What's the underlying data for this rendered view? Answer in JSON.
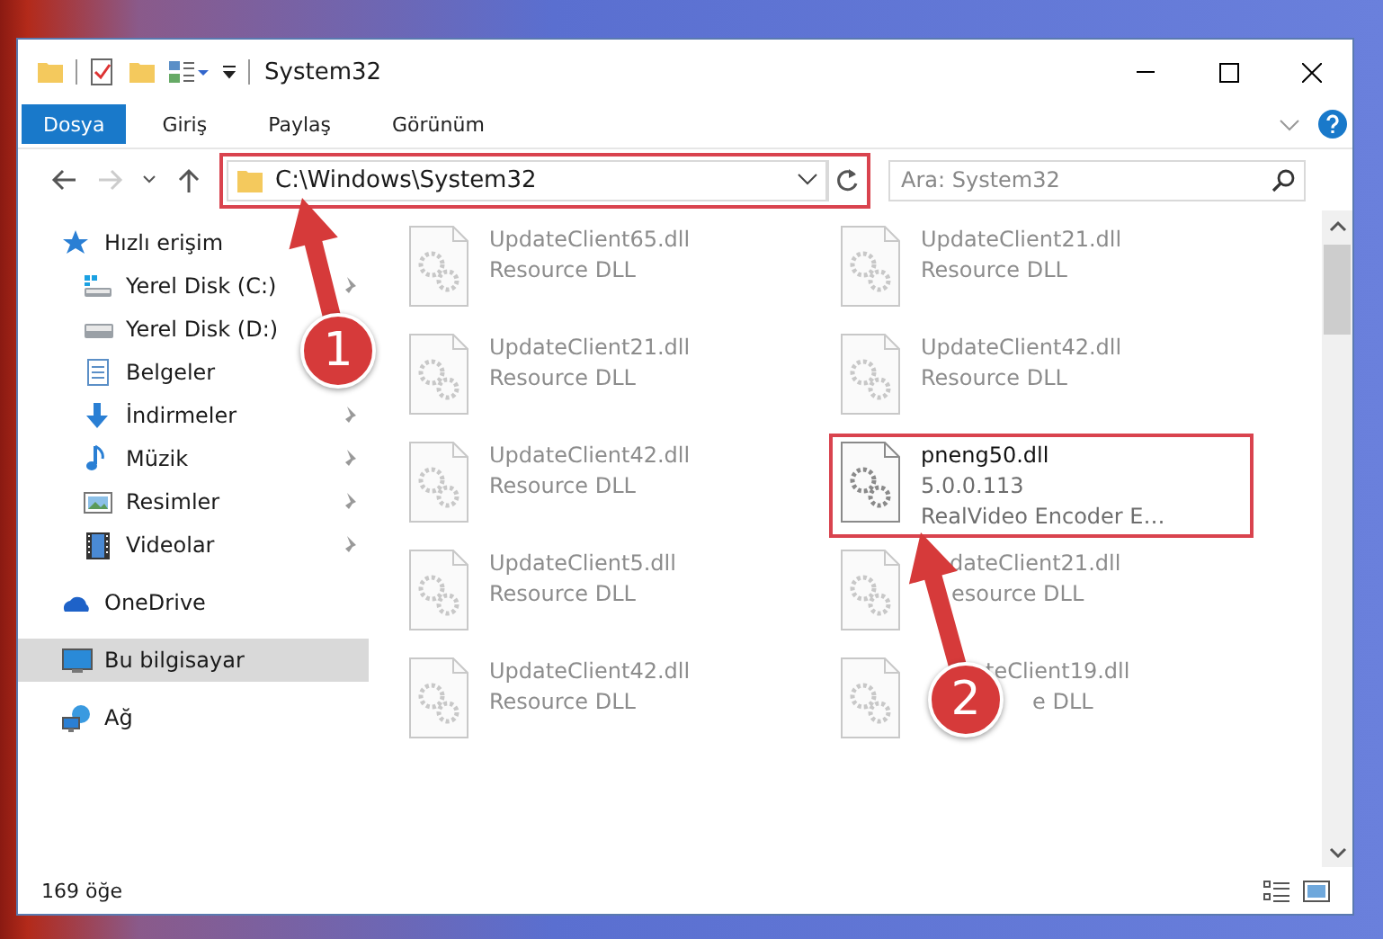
{
  "window": {
    "title": "System32"
  },
  "ribbon": {
    "tabs": [
      {
        "label": "Dosya",
        "kind": "file",
        "selected": false
      },
      {
        "label": "Giriş",
        "kind": "tab",
        "selected": false
      },
      {
        "label": "Paylaş",
        "kind": "tab",
        "selected": false
      },
      {
        "label": "Görünüm",
        "kind": "tab",
        "selected": false
      }
    ]
  },
  "address": {
    "path": "C:\\Windows\\System32",
    "highlighted": true
  },
  "search": {
    "placeholder": "Ara: System32"
  },
  "sidebar": {
    "items": [
      {
        "label": "Hızlı erişim",
        "kind": "star",
        "selected": false,
        "children": [
          {
            "label": "Yerel Disk (C:)",
            "kind": "drive-c",
            "pinned": true,
            "selected": false
          },
          {
            "label": "Yerel Disk (D:)",
            "kind": "drive",
            "pinned": false,
            "selected": false
          },
          {
            "label": "Belgeler",
            "kind": "document",
            "pinned": false,
            "selected": false
          },
          {
            "label": "İndirmeler",
            "kind": "download",
            "pinned": true,
            "selected": false
          },
          {
            "label": "Müzik",
            "kind": "music",
            "pinned": true,
            "selected": false
          },
          {
            "label": "Resimler",
            "kind": "pictures",
            "pinned": true,
            "selected": false
          },
          {
            "label": "Videolar",
            "kind": "videos",
            "pinned": true,
            "selected": false
          }
        ]
      },
      {
        "label": "OneDrive",
        "kind": "cloud",
        "selected": false
      },
      {
        "label": "Bu bilgisayar",
        "kind": "computer",
        "selected": true
      },
      {
        "label": "Ağ",
        "kind": "network",
        "selected": false
      }
    ]
  },
  "files": [
    {
      "name": "UpdateClient65.dll",
      "lines": [
        "Resource DLL"
      ],
      "blurred": true,
      "highlighted": false
    },
    {
      "name": "UpdateClient21.dll",
      "lines": [
        "Resource DLL"
      ],
      "blurred": true,
      "highlighted": false
    },
    {
      "name": "UpdateClient21.dll",
      "lines": [
        "Resource DLL"
      ],
      "blurred": true,
      "highlighted": false
    },
    {
      "name": "UpdateClient42.dll",
      "lines": [
        "Resource DLL"
      ],
      "blurred": true,
      "highlighted": false
    },
    {
      "name": "UpdateClient42.dll",
      "lines": [
        "Resource DLL"
      ],
      "blurred": true,
      "highlighted": false
    },
    {
      "name": "pneng50.dll",
      "lines": [
        "5.0.0.113",
        "RealVideo Encoder E…"
      ],
      "blurred": false,
      "highlighted": true
    },
    {
      "name": "UpdateClient5.dll",
      "lines": [
        "Resource DLL"
      ],
      "blurred": true,
      "highlighted": false
    },
    {
      "name": "dateClient21.dll",
      "lines": [
        "esource DLL"
      ],
      "blurred": true,
      "highlighted": false
    },
    {
      "name": "UpdateClient42.dll",
      "lines": [
        "Resource DLL"
      ],
      "blurred": true,
      "highlighted": false
    },
    {
      "name": "teClient19.dll",
      "lines": [
        "e DLL"
      ],
      "blurred": true,
      "highlighted": false
    }
  ],
  "status_bar": {
    "count": "169 öğe"
  },
  "annotations": [
    {
      "number": "1"
    },
    {
      "number": "2"
    }
  ]
}
